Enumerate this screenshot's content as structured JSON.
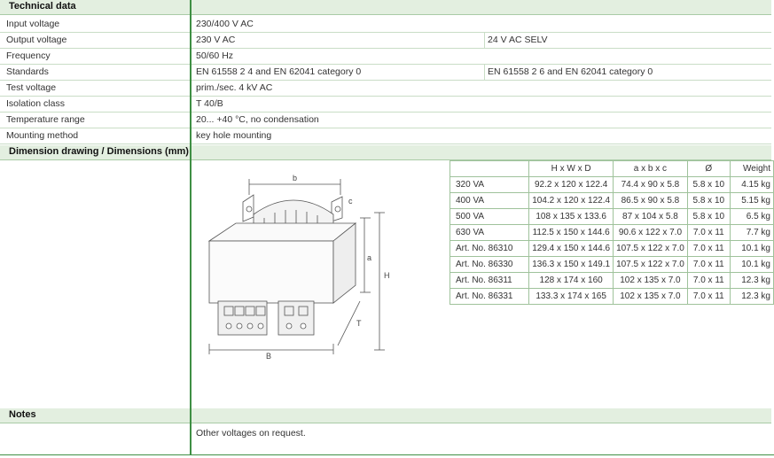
{
  "technical": {
    "heading": "Technical data",
    "rows": [
      {
        "label": "Input voltage",
        "value1": "230/400 V AC",
        "value2": ""
      },
      {
        "label": "Output voltage",
        "value1": "230 V AC",
        "value2": "24 V AC  SELV"
      },
      {
        "label": "Frequency",
        "value1": "50/60 Hz",
        "value2": ""
      },
      {
        "label": "Standards",
        "value1": "EN 61558 2 4 and EN 62041 category 0",
        "value2": "EN 61558 2 6 and EN 62041 category 0"
      },
      {
        "label": "Test voltage",
        "value1": "prim./sec. 4 kV AC",
        "value2": ""
      },
      {
        "label": "Isolation class",
        "value1": "T 40/B",
        "value2": ""
      },
      {
        "label": "Temperature range",
        "value1": "20... +40 °C, no condensation",
        "value2": ""
      },
      {
        "label": "Mounting method",
        "value1": "key hole mounting",
        "value2": ""
      }
    ]
  },
  "dimensions": {
    "heading": "Dimension drawing / Dimensions (mm)",
    "columns": [
      "",
      "H x W x D",
      "a x b x c",
      "Ø",
      "Weight"
    ],
    "rows": [
      [
        "320  VA",
        "92.2 x 120 x 122.4",
        "74.4 x 90 x 5.8",
        "5.8 x 10",
        "4.15  kg"
      ],
      [
        "400  VA",
        "104.2 x 120 x 122.4",
        "86.5 x 90 x 5.8",
        "5.8 x 10",
        "5.15  kg"
      ],
      [
        "500  VA",
        "108 x 135 x 133.6",
        "87 x 104 x 5.8",
        "5.8 x 10",
        "6.5  kg"
      ],
      [
        "630  VA",
        "112.5 x 150 x 144.6",
        "90.6 x 122 x 7.0",
        "7.0 x 11",
        "7.7  kg"
      ],
      [
        "Art. No. 86310",
        "129.4 x 150 x 144.6",
        "107.5 x 122 x 7.0",
        "7.0 x 11",
        "10.1  kg"
      ],
      [
        "Art. No. 86330",
        "136.3 x 150 x 149.1",
        "107.5 x 122 x 7.0",
        "7.0 x 11",
        "10.1  kg"
      ],
      [
        "Art. No. 86311",
        "128 x 174 x 160",
        "102 x 135 x 7.0",
        "7.0 x 11",
        "12.3  kg"
      ],
      [
        "Art. No. 86331",
        "133.3 x 174 x 165",
        "102 x 135 x 7.0",
        "7.0 x 11",
        "12.3  kg"
      ]
    ],
    "drawing_labels": {
      "b": "b",
      "c": "c",
      "a": "a",
      "H": "H",
      "T": "T",
      "B": "B"
    }
  },
  "notes": {
    "heading": "Notes",
    "text": "Other voltages on request."
  },
  "colors": {
    "accent": "#3f8f44",
    "header_bg": "#e3efe0",
    "row_line": "#c9ddc6"
  }
}
